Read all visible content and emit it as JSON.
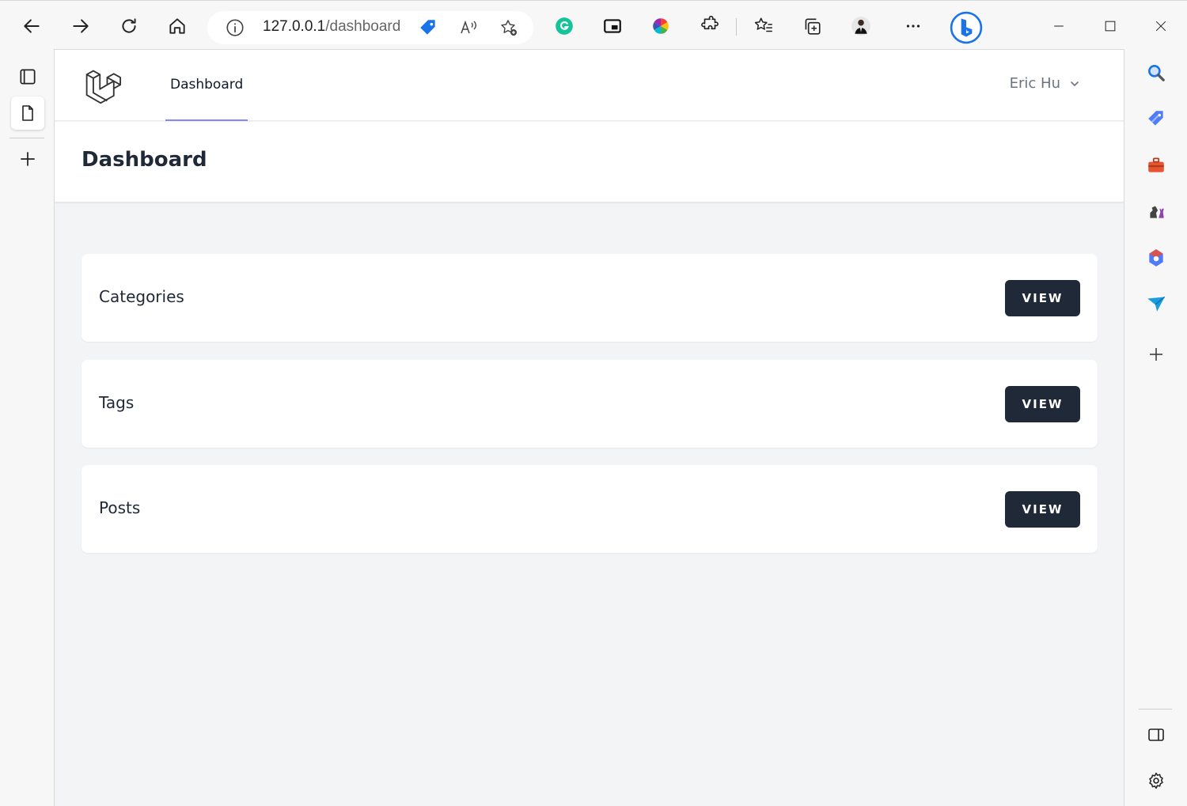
{
  "browser": {
    "url_host": "127.0.0.1",
    "url_path": "/dashboard",
    "colors": {
      "toolbar_bg": "#f7f7f7",
      "accent_blue": "#1a73e8"
    }
  },
  "nav": {
    "brand": "laravel-logo-icon",
    "links": [
      {
        "label": "Dashboard",
        "active": true
      }
    ],
    "user_name": "Eric Hu",
    "colors": {
      "active_underline": "#818cf8"
    }
  },
  "header": {
    "title": "Dashboard"
  },
  "cards": [
    {
      "label": "Categories",
      "button": "VIEW"
    },
    {
      "label": "Tags",
      "button": "VIEW"
    },
    {
      "label": "Posts",
      "button": "VIEW"
    }
  ],
  "theme": {
    "button_bg": "#1f2937",
    "page_bg": "#f3f4f6",
    "card_bg": "#ffffff"
  }
}
